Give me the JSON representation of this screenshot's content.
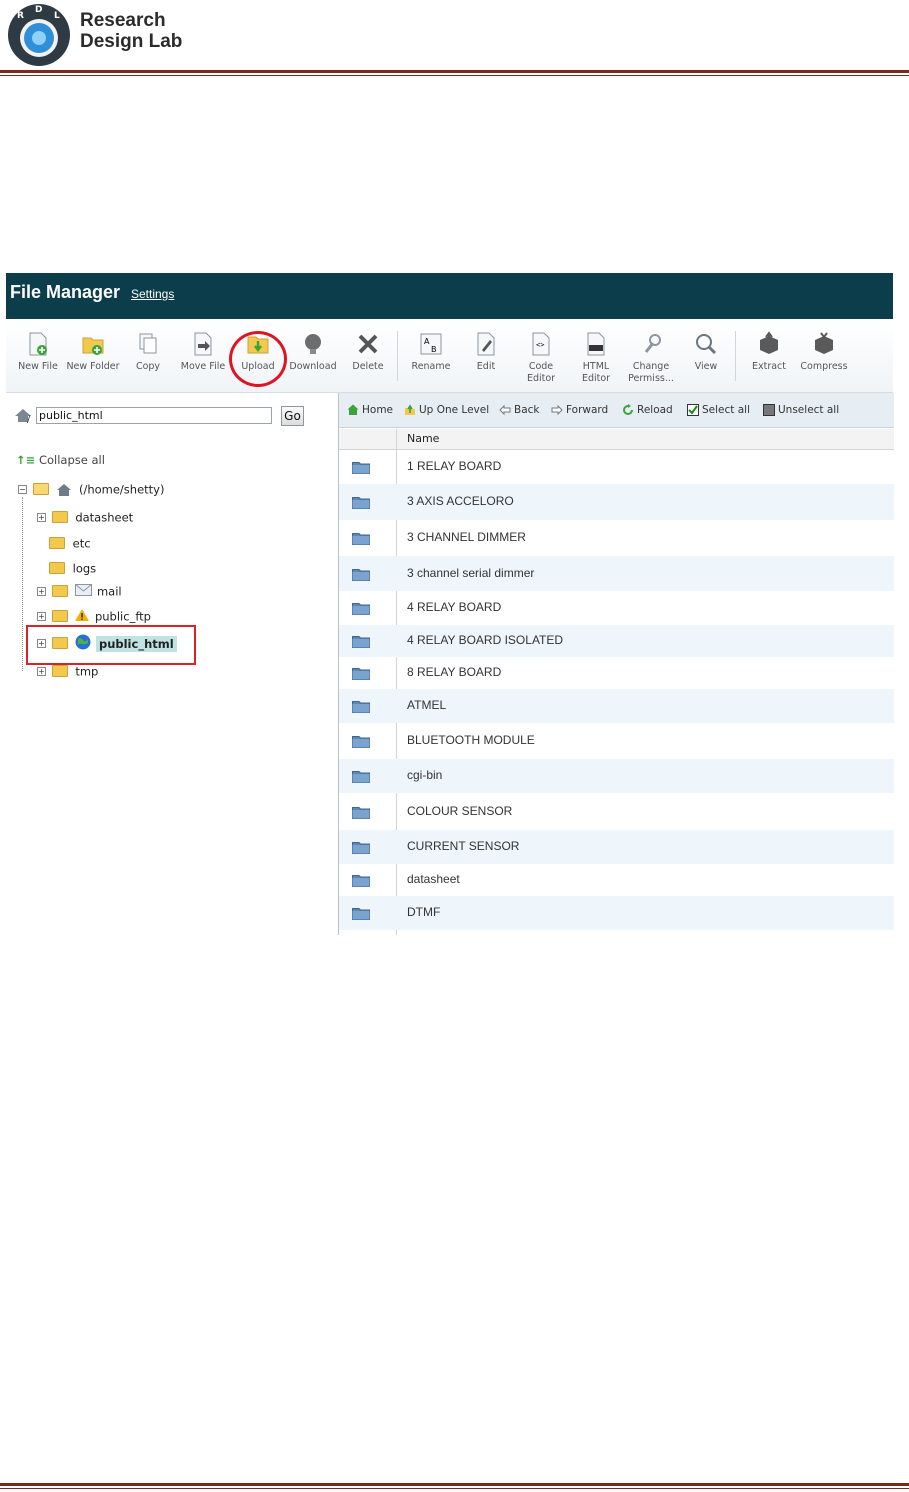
{
  "document": {
    "logo_text_line1": "Research",
    "logo_text_line2": "Design Lab",
    "logo_letters": [
      "R",
      "D",
      "L"
    ]
  },
  "file_manager": {
    "title": "File Manager",
    "settings_link": "Settings",
    "toolbar": [
      {
        "label": "New File",
        "icon": "new-file-icon"
      },
      {
        "label": "New Folder",
        "icon": "new-folder-icon"
      },
      {
        "label": "Copy",
        "icon": "copy-icon"
      },
      {
        "label": "Move File",
        "icon": "move-file-icon"
      },
      {
        "label": "Upload",
        "icon": "upload-icon"
      },
      {
        "label": "Download",
        "icon": "download-icon"
      },
      {
        "label": "Delete",
        "icon": "delete-icon"
      },
      {
        "label": "Rename",
        "icon": "rename-icon"
      },
      {
        "label": "Edit",
        "icon": "edit-icon"
      },
      {
        "label": "Code Editor",
        "icon": "code-editor-icon"
      },
      {
        "label": "HTML Editor",
        "icon": "html-editor-icon"
      },
      {
        "label": "Change Permiss...",
        "icon": "change-permissions-icon"
      },
      {
        "label": "View",
        "icon": "view-icon"
      },
      {
        "label": "Extract",
        "icon": "extract-icon"
      },
      {
        "label": "Compress",
        "icon": "compress-icon"
      }
    ],
    "path_input_value": "public_html",
    "go_button": "Go",
    "collapse_all": "Collapse all",
    "tree": {
      "root": "(/home/shetty)",
      "items": [
        "datasheet",
        "etc",
        "logs",
        "mail",
        "public_ftp",
        "public_html",
        "tmp"
      ],
      "selected": "public_html"
    },
    "nav": [
      "Home",
      "Up One Level",
      "Back",
      "Forward",
      "Reload",
      "Select all",
      "Unselect all"
    ],
    "table_header": "Name",
    "files": [
      "1 RELAY BOARD",
      "3 AXIS ACCELORO",
      "3 CHANNEL DIMMER",
      "3 channel serial dimmer",
      "4 RELAY BOARD",
      "4 RELAY BOARD ISOLATED",
      "8 RELAY BOARD",
      "ATMEL",
      "BLUETOOTH MODULE",
      "cgi-bin",
      "COLOUR SENSOR",
      "CURRENT SENSOR",
      "datasheet",
      "DTMF"
    ],
    "colors": {
      "titlebar": "#0b3d4a",
      "highlight_red": "#e0141e",
      "rule": "#7b2a1c"
    }
  }
}
